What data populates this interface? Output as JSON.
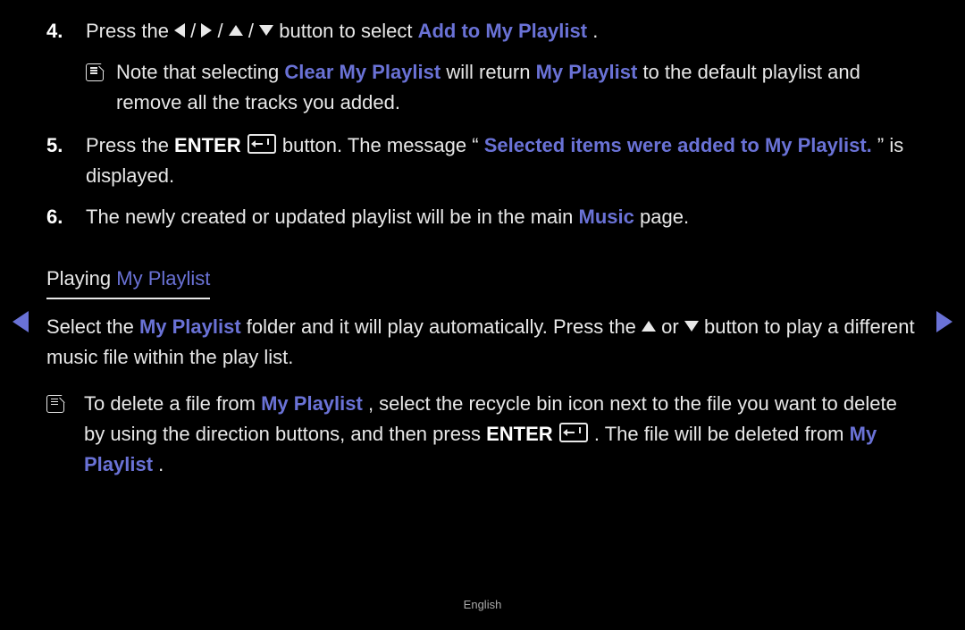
{
  "steps": {
    "item4": {
      "num": "4.",
      "pre": "Press the ",
      "post": " button to select ",
      "highlight": "Add to My Playlist",
      "end": ".",
      "note_pre": "Note that selecting ",
      "note_hl1": "Clear My Playlist",
      "note_mid": " will return ",
      "note_hl2": "My Playlist",
      "note_post": " to the default playlist and remove all the tracks you added."
    },
    "item5": {
      "num": "5.",
      "pre": "Press the ",
      "enter": "ENTER",
      "mid": " button. The message “",
      "highlight": "Selected items were added to My Playlist.",
      "post": "” is displayed."
    },
    "item6": {
      "num": "6.",
      "pre": "The newly created or updated playlist will be in the main ",
      "highlight": "Music",
      "post": " page."
    }
  },
  "section": {
    "title_pre": "Playing ",
    "title_hl": "My Playlist",
    "body_pre": "Select the ",
    "body_hl": "My Playlist",
    "body_mid": " folder and it will play automatically. Press the ",
    "body_or": " or ",
    "body_post": " button to play a different music file within the play list.",
    "note_pre": "To delete a file from ",
    "note_hl1": "My Playlist",
    "note_mid1": ", select the recycle bin icon next to the file you want to delete by using the direction buttons, and then press ",
    "note_enter": "ENTER",
    "note_mid2": ". The file will be deleted from ",
    "note_hl2": "My Playlist",
    "note_end": "."
  },
  "footer": "English",
  "sep": " / "
}
